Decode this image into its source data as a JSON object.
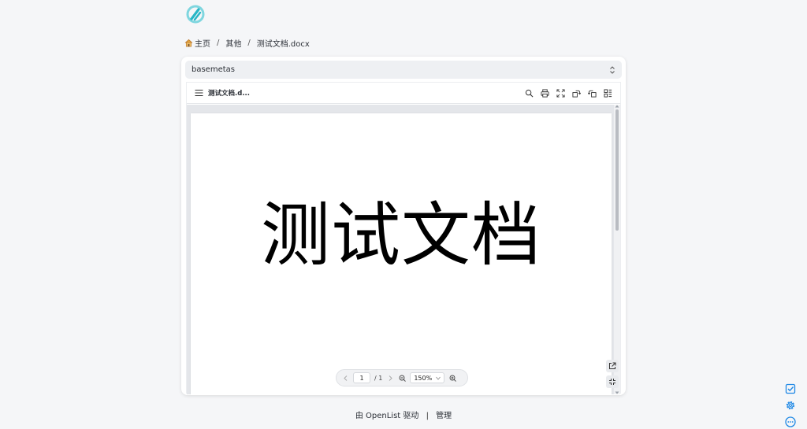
{
  "colors": {
    "accent": "#1e88e5",
    "logo_primary": "#29b6c6",
    "logo_secondary": "#7fd6df"
  },
  "header": {
    "logo": "openlist-logo-icon"
  },
  "breadcrumb": {
    "items": [
      {
        "label": "主页",
        "icon": "home-icon"
      },
      {
        "label": "其他"
      },
      {
        "label": "测试文档.docx"
      }
    ],
    "separator": "/"
  },
  "storage_selector": {
    "value": "basemetas",
    "icon": "chevron-updown-icon"
  },
  "viewer": {
    "toolbar": {
      "file_name": "测试文档.d...",
      "buttons": [
        "search-icon",
        "print-icon",
        "fullscreen-icon",
        "rotate-right-icon",
        "rotate-left-icon",
        "thumbnails-icon"
      ]
    },
    "document": {
      "content": "测试文档"
    },
    "pager": {
      "current_page": "1",
      "total_pages": "/ 1",
      "zoom": "150%"
    },
    "float_buttons": [
      "open-external-icon",
      "exit-fullscreen-icon"
    ]
  },
  "footer": {
    "powered_by": "由 OpenList 驱动",
    "separator": "|",
    "admin": "管理"
  },
  "side_tools": [
    "checkbox-icon",
    "settings-icon",
    "more-icon"
  ]
}
